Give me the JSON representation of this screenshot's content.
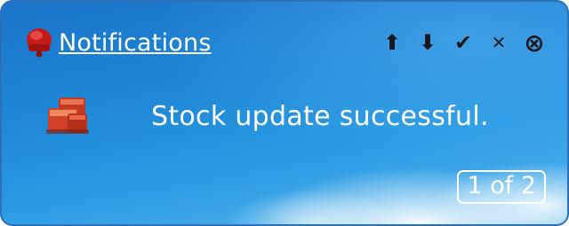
{
  "notification": {
    "title": "Notifications",
    "message": "Stock update successful.",
    "pager": "1 of 2"
  },
  "toolbar": {
    "up_glyph": "⬆",
    "down_glyph": "⬇",
    "check_glyph": "✔",
    "dismiss_glyph": "✕",
    "close_glyph": "⊗"
  },
  "icons": {
    "header": "red-bell-icon",
    "app": "stacked-boxes-icon",
    "up": "arrow-up-icon",
    "down": "arrow-down-icon",
    "check": "checkmark-icon",
    "dismiss": "x-mark-icon",
    "close": "circle-x-icon"
  },
  "colors": {
    "background_top": "#1b74c9",
    "background_bottom": "#5ab7ee",
    "border": "#2d6fb8",
    "text": "#ffffff",
    "toolbar_icon": "#111820",
    "bell": "#d6221e",
    "app_icon": "#d2402a"
  }
}
